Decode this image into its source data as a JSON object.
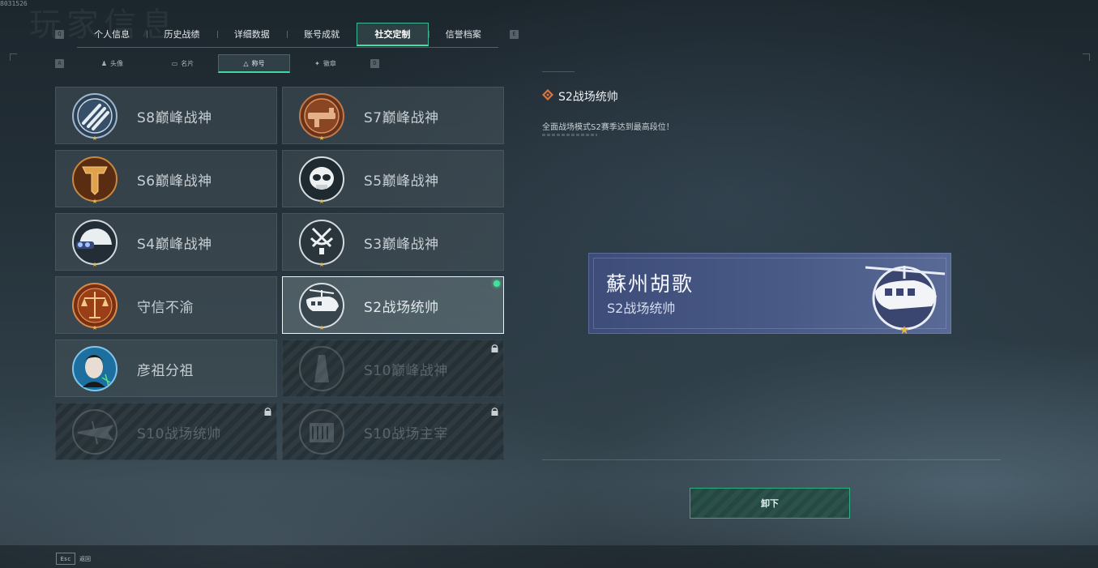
{
  "corner_id": "8031526",
  "bg_title": "玩家信息",
  "tab_key_left": "Q",
  "tab_key_right": "E",
  "main_tabs": [
    "个人信息",
    "历史战绩",
    "详细数据",
    "账号成就",
    "社交定制",
    "信誉档案"
  ],
  "main_tab_active": 4,
  "sub_key_left": "A",
  "sub_key_right": "D",
  "sub_tabs": [
    {
      "icon": "person-icon",
      "glyph": "♟",
      "label": "头像"
    },
    {
      "icon": "nameplate-icon",
      "glyph": "▭",
      "label": "名片"
    },
    {
      "icon": "title-triangle-icon",
      "glyph": "△",
      "label": "称号"
    },
    {
      "icon": "badge-icon",
      "glyph": "✦",
      "label": "徽章"
    }
  ],
  "sub_tab_active": 2,
  "titles": [
    {
      "name": "S8巅峰战神",
      "emblem": "slash-badge-icon",
      "locked": false,
      "selected": false
    },
    {
      "name": "S7巅峰战神",
      "emblem": "bronze-gun-badge-icon",
      "locked": false,
      "selected": false
    },
    {
      "name": "S6巅峰战神",
      "emblem": "gold-t-badge-icon",
      "locked": false,
      "selected": false
    },
    {
      "name": "S5巅峰战神",
      "emblem": "skull-badge-icon",
      "locked": false,
      "selected": false
    },
    {
      "name": "S4巅峰战神",
      "emblem": "helmet-badge-icon",
      "locked": false,
      "selected": false
    },
    {
      "name": "S3巅峰战神",
      "emblem": "satellite-badge-icon",
      "locked": false,
      "selected": false
    },
    {
      "name": "守信不渝",
      "emblem": "scales-badge-icon",
      "locked": false,
      "selected": false
    },
    {
      "name": "S2战场统帅",
      "emblem": "helicopter-badge-icon",
      "locked": false,
      "selected": true
    },
    {
      "name": "彦祖分祖",
      "emblem": "portrait-badge-icon",
      "locked": false,
      "selected": false
    },
    {
      "name": "S10巅峰战神",
      "emblem": "tower-badge-icon",
      "locked": true,
      "selected": false
    },
    {
      "name": "S10战场统帅",
      "emblem": "plane-badge-icon",
      "locked": true,
      "selected": false
    },
    {
      "name": "S10战场主宰",
      "emblem": "colosseum-badge-icon",
      "locked": true,
      "selected": false
    }
  ],
  "detail": {
    "title": "S2战场统帅",
    "description": "全面战场模式S2赛季达到最高段位！"
  },
  "nameplate": {
    "player_name": "蘇州胡歌",
    "title": "S2战场统帅"
  },
  "unequip_label": "卸下",
  "esc": {
    "key": "Esc",
    "label": "返回"
  },
  "colors": {
    "accent_green": "#3fe29a",
    "nameplate_blue": "#4a5a87",
    "bronze": "#a0552a",
    "gold": "#c89b45"
  }
}
